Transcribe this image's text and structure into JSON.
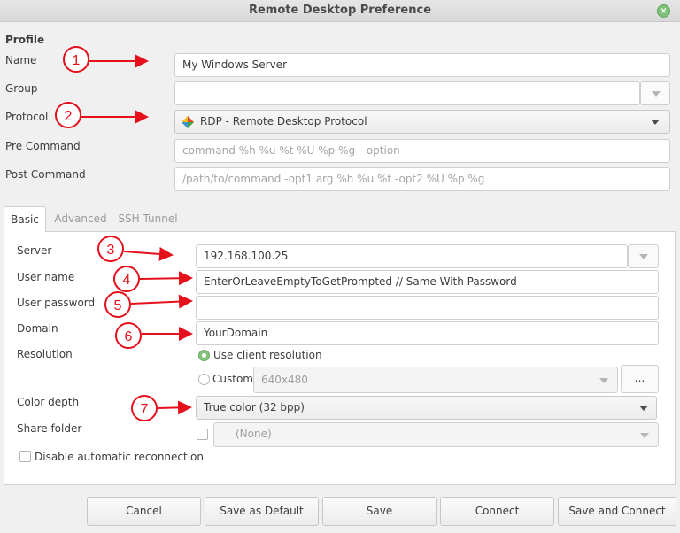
{
  "window": {
    "title": "Remote Desktop Preference",
    "close_glyph": "×"
  },
  "profile": {
    "heading": "Profile",
    "name_label": "Name",
    "name_value": "My Windows Server",
    "group_label": "Group",
    "group_value": "",
    "protocol_label": "Protocol",
    "protocol_value": "RDP - Remote Desktop Protocol",
    "protocol_icon": "rdp-protocol-icon",
    "pre_label": "Pre Command",
    "pre_placeholder": "command %h %u %t %U %p %g --option",
    "post_label": "Post Command",
    "post_placeholder": "/path/to/command -opt1 arg %h %u %t -opt2 %U %p %g"
  },
  "tabs": [
    {
      "label": "Basic",
      "active": true
    },
    {
      "label": "Advanced",
      "active": false
    },
    {
      "label": "SSH Tunnel",
      "active": false
    }
  ],
  "basic": {
    "server_label": "Server",
    "server_value": "192.168.100.25",
    "username_label": "User name",
    "username_value": "EnterOrLeaveEmptyToGetPrompted // Same With Password",
    "password_label": "User password",
    "password_value": "",
    "domain_label": "Domain",
    "domain_value": "YourDomain",
    "resolution_label": "Resolution",
    "use_client_label": "Use client resolution",
    "custom_label": "Custom",
    "custom_value": "640x480",
    "custom_button_label": "...",
    "color_depth_label": "Color depth",
    "color_depth_value": "True color (32 bpp)",
    "share_folder_label": "Share folder",
    "share_folder_value": "(None)",
    "disable_reconnect_label": "Disable automatic reconnection"
  },
  "annotations": [
    "1",
    "2",
    "3",
    "4",
    "5",
    "6",
    "7"
  ],
  "buttons": {
    "cancel": "Cancel",
    "save_default": "Save as Default",
    "save": "Save",
    "connect": "Connect",
    "save_connect": "Save and Connect"
  },
  "colors": {
    "annotation_red": "#e5101c",
    "radio_green": "#86c37f"
  }
}
